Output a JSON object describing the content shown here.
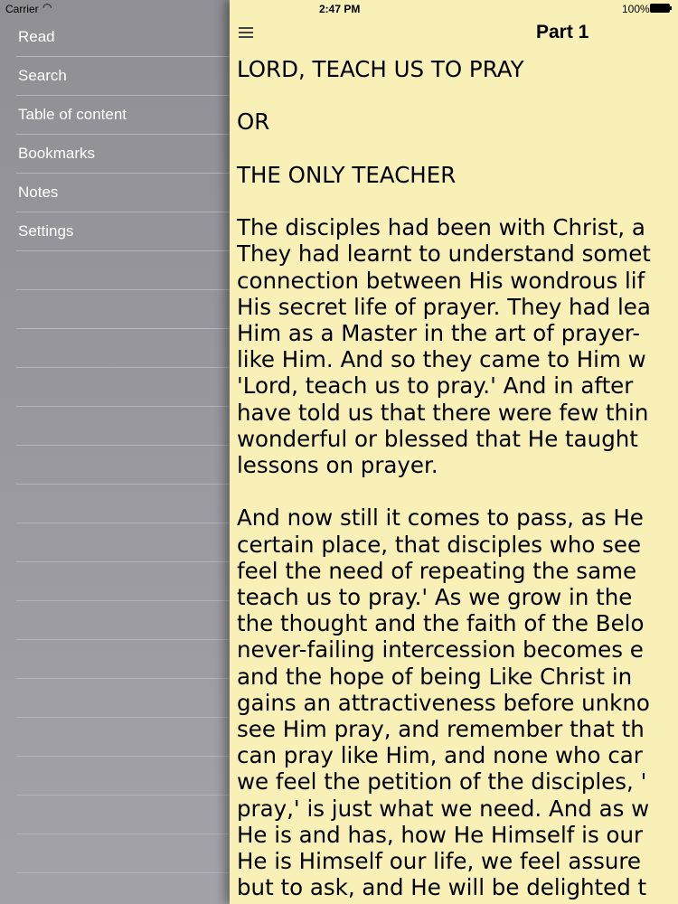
{
  "status_bar": {
    "carrier": "Carrier",
    "time": "2:47 PM",
    "battery": "100%"
  },
  "sidebar": {
    "items": [
      {
        "label": "Read"
      },
      {
        "label": "Search"
      },
      {
        "label": "Table of content"
      },
      {
        "label": "Bookmarks"
      },
      {
        "label": "Notes"
      },
      {
        "label": "Settings"
      }
    ]
  },
  "reader": {
    "title": "Part 1",
    "paragraphs": [
      [
        "LORD, TEACH US TO PRAY"
      ],
      [
        "OR"
      ],
      [
        "THE ONLY TEACHER"
      ],
      [
        "The disciples had been with Christ, a",
        "They had learnt to understand somet",
        "connection between His wondrous lif",
        "His secret life of prayer. They had lea",
        "Him as a Master in the art of prayer-",
        "like Him. And so they came to Him w",
        "'Lord, teach us to pray.' And in after",
        "have told us that there were few thin",
        "wonderful or blessed that He taught",
        "lessons on prayer."
      ],
      [
        "And now still it comes to pass, as He",
        "certain place, that disciples who see",
        "feel the need of repeating the same",
        "teach us to pray.' As we grow in the",
        "the thought and the faith of the Belo",
        "never-failing intercession becomes e",
        "and the hope of being Like Christ in",
        "gains an attractiveness before unkno",
        "see Him pray, and remember that th",
        "can pray like Him, and none who car",
        "we feel the petition of the disciples, '",
        "pray,' is just what we need. And as w",
        "He is and has, how He Himself is our",
        "He is Himself our life, we feel assure",
        "but to ask, and He will be delighted t"
      ]
    ]
  }
}
